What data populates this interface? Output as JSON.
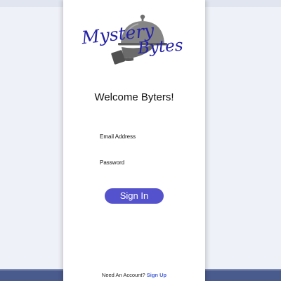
{
  "logo": {
    "word1": "Mystery",
    "word2": "Bytes",
    "icon": "cloche-on-hand-icon",
    "text_color": "#2623a8"
  },
  "welcome": "Welcome Byters!",
  "form": {
    "email_label": "Email Address",
    "email_value": "",
    "password_label": "Password",
    "password_value": ""
  },
  "sign_in_label": "Sign In",
  "footer": {
    "prompt": "Need An Account?",
    "link_label": "Sign Up"
  },
  "colors": {
    "background": "#eef1f7",
    "card": "#ffffff",
    "button": "#5452cc",
    "link": "#4a63d9",
    "bottom_bar": "#495a8c"
  }
}
